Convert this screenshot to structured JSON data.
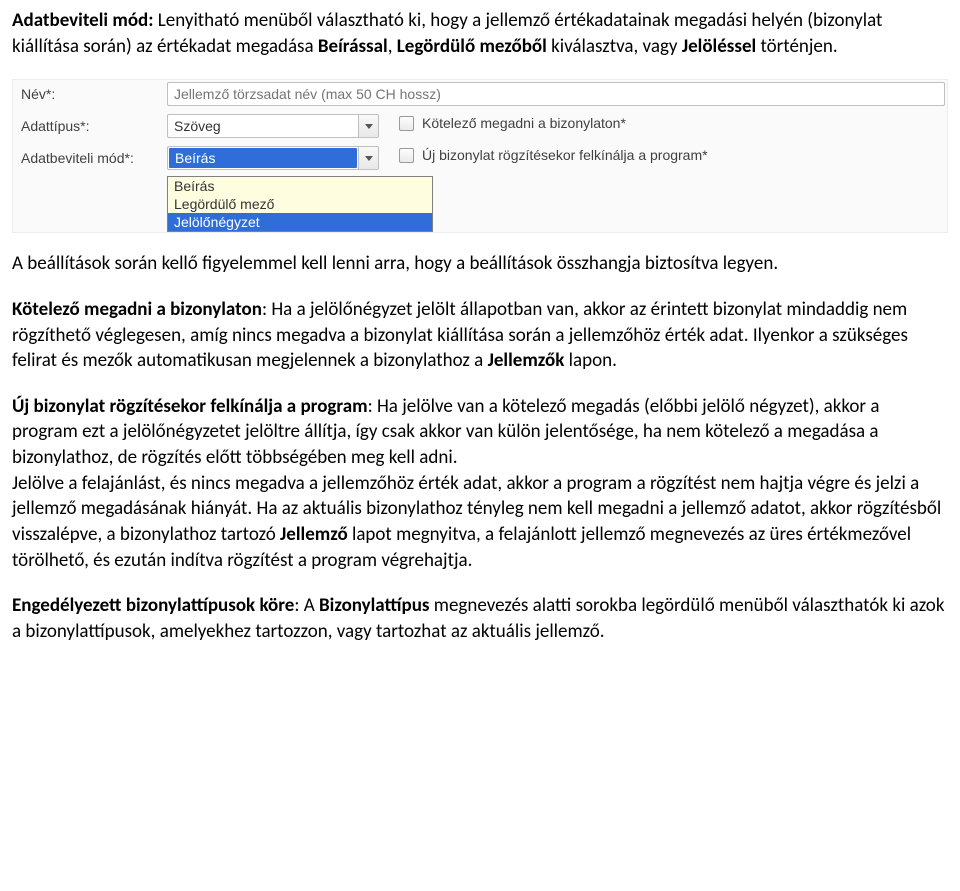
{
  "para1": {
    "b1": "Adatbeviteli mód:",
    "t1": " Lenyitható menüből választható ki, hogy a jellemző értékadatainak megadási helyén (bizonylat kiállítása során) az értékadat megadása ",
    "b2": "Beírással",
    "t2": ", ",
    "b3": "Legördülő mezőből",
    "t3": " kiválasztva, vagy ",
    "b4": "Jelöléssel",
    "t4": " történjen."
  },
  "form": {
    "label_nev": "Név*:",
    "label_adattipus": "Adattípus*:",
    "label_adatbeviteli": "Adatbeviteli mód*:",
    "input_placeholder": "Jellemző törzsadat név (max 50 CH hossz)",
    "adattipus_value": "Szöveg",
    "adatbeviteli_value": "Beírás",
    "cb1_label": "Kötelező megadni a bizonylaton*",
    "cb2_label": "Új bizonylat rögzítésekor felkínálja a program*",
    "dropdown_items": {
      "i0": "Beírás",
      "i1": "Legördülő mező",
      "i2": "Jelölőnégyzet"
    }
  },
  "para2": "A beállítások során kellő figyelemmel kell lenni arra, hogy a beállítások összhangja biztosítva legyen.",
  "para3": {
    "b1": "Kötelező megadni a bizonylaton",
    "t1": ": Ha a jelölőnégyzet jelölt állapotban van, akkor az érintett bizonylat mindaddig nem rögzíthető véglegesen, amíg nincs megadva a bizonylat kiállítása során a jellemzőhöz érték adat. Ilyenkor a szükséges felirat és mezők automatikusan megjelennek a bizonylathoz a ",
    "b2": "Jellemzők",
    "t2": " lapon."
  },
  "para4": {
    "b1": "Új bizonylat rögzítésekor felkínálja a program",
    "t1": ": Ha jelölve van a kötelező megadás (előbbi jelölő négyzet), akkor a program ezt a jelölőnégyzetet jelöltre állítja, így csak akkor van külön jelentősége, ha nem kötelező a megadása a bizonylathoz, de rögzítés előtt többségében meg kell adni.",
    "t2": "Jelölve a felajánlást, és nincs megadva a jellemzőhöz érték adat, akkor a program a rögzítést nem hajtja végre és jelzi a jellemző megadásának hiányát. Ha az aktuális bizonylathoz tényleg nem kell megadni a jellemző adatot, akkor rögzítésből visszalépve, a bizonylathoz tartozó ",
    "b2": "Jellemző",
    "t3": " lapot megnyitva, a felajánlott jellemző megnevezés az üres értékmezővel törölhető, és ezután indítva rögzítést a program végrehajtja."
  },
  "para5": {
    "b1": "Engedélyezett bizonylattípusok köre",
    "t1": ": A ",
    "b2": "Bizonylattípus",
    "t2": " megnevezés alatti sorokba legördülő menüből választhatók ki azok a bizonylattípusok, amelyekhez tartozzon, vagy tartozhat az aktuális jellemző."
  }
}
